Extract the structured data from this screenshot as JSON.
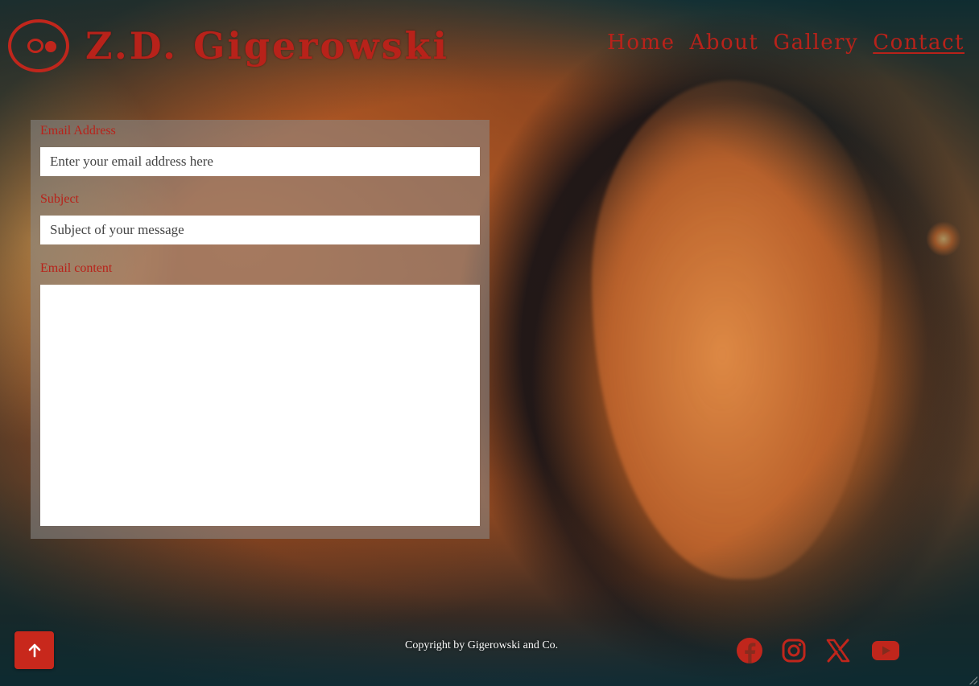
{
  "brand": {
    "title": "Z.D. Gigerowski",
    "logo_icon": "eye-logo-icon",
    "accent_color": "#b8221a"
  },
  "nav": {
    "items": [
      {
        "label": "Home",
        "active": false
      },
      {
        "label": "About",
        "active": false
      },
      {
        "label": "Gallery",
        "active": false
      },
      {
        "label": "Contact",
        "active": true
      }
    ]
  },
  "form": {
    "email": {
      "label": "Email Address",
      "placeholder": "Enter your email address here",
      "value": ""
    },
    "subject": {
      "label": "Subject",
      "placeholder": "Subject of your message",
      "value": ""
    },
    "content": {
      "label": "Email content",
      "value": ""
    }
  },
  "footer": {
    "copyright": "Copyright by Gigerowski and Co.",
    "back_to_top_icon": "arrow-up-icon",
    "social": [
      {
        "name": "facebook-icon"
      },
      {
        "name": "instagram-icon"
      },
      {
        "name": "x-twitter-icon"
      },
      {
        "name": "youtube-icon"
      }
    ]
  }
}
